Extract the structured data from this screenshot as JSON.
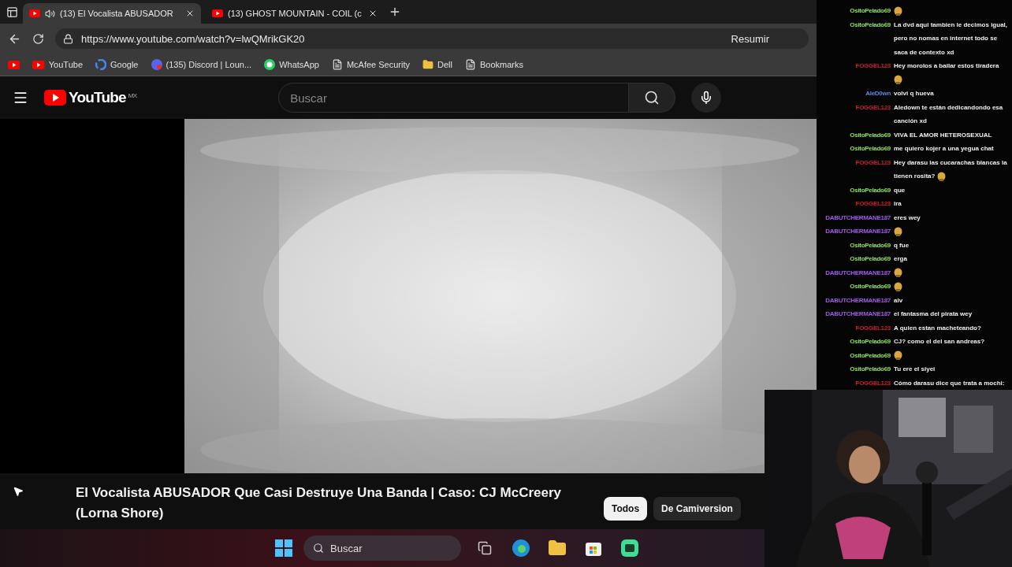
{
  "browser": {
    "tabs": [
      {
        "title": "(13) El Vocalista ABUSADOR",
        "selected": true,
        "audio": true
      },
      {
        "title": "(13) GHOST MOUNTAIN - COIL (c",
        "selected": false,
        "audio": false
      }
    ],
    "address": "https://www.youtube.com/watch?v=lwQMrikGK20",
    "summarize": "Resumir",
    "bookmarks": [
      {
        "kind": "youtube"
      },
      {
        "label": "YouTube",
        "kind": "youtube"
      },
      {
        "label": "Google",
        "kind": "google"
      },
      {
        "label": "(135) Discord | Loun...",
        "kind": "discord"
      },
      {
        "label": "WhatsApp",
        "kind": "whatsapp"
      },
      {
        "label": "McAfee Security",
        "kind": "page"
      },
      {
        "label": "Dell",
        "kind": "folder"
      },
      {
        "label": "Bookmarks",
        "kind": "page"
      }
    ]
  },
  "youtube": {
    "logo": "YouTube",
    "region": "MX",
    "search_placeholder": "Buscar",
    "title": "El Vocalista ABUSADOR Que Casi Destruye Una Banda | Caso: CJ McCreery (Lorna Shore)",
    "chips": [
      {
        "label": "Todos",
        "selected": true
      },
      {
        "label": "De Camiversion",
        "selected": false
      }
    ]
  },
  "chat": [
    {
      "user": "OsitoPelado69",
      "color": "#8fe05a",
      "emote": true
    },
    {
      "user": "OsitoPelado69",
      "color": "#8fe05a",
      "text": "La dvd aqui tambien le decimos igual, pero no nomas en internet todo se saca de contexto xd",
      "emote": false
    },
    {
      "user": "FOGGEL123",
      "color": "#c8202c",
      "text": "Hey morolos a bailar estos tiradera",
      "emote": true
    },
    {
      "user": "AleD0wn",
      "color": "#5a8ae8",
      "text": "volvi q hueva",
      "emote": false
    },
    {
      "user": "FOGGEL123",
      "color": "#c8202c",
      "text": "Aledown te están dedicandondo esa canción xd",
      "emote": false
    },
    {
      "user": "OsitoPelado69",
      "color": "#8fe05a",
      "text": "VIVA EL AMOR HETEROSEXUAL",
      "emote": false
    },
    {
      "user": "OsitoPelado69",
      "color": "#8fe05a",
      "text": "me quiero kojer a una yegua chat",
      "emote": false
    },
    {
      "user": "FOGGEL123",
      "color": "#c8202c",
      "text": "Hey darasu las cucarachas blancas la tienen rosita?",
      "emote": true
    },
    {
      "user": "OsitoPelado69",
      "color": "#8fe05a",
      "text": "que",
      "emote": false
    },
    {
      "user": "FOGGEL123",
      "color": "#c8202c",
      "text": "ira",
      "emote": false
    },
    {
      "user": "DABUTCHERMANE187",
      "color": "#a05ae8",
      "text": "eres wey",
      "emote": false
    },
    {
      "user": "DABUTCHERMANE187",
      "color": "#a05ae8",
      "emote": true
    },
    {
      "user": "OsitoPelado69",
      "color": "#8fe05a",
      "text": "q fue",
      "emote": false
    },
    {
      "user": "OsitoPelado69",
      "color": "#8fe05a",
      "text": "erga",
      "emote": false
    },
    {
      "user": "DABUTCHERMANE187",
      "color": "#a05ae8",
      "emote": true
    },
    {
      "user": "OsitoPelado69",
      "color": "#8fe05a",
      "emote": true
    },
    {
      "user": "DABUTCHERMANE187",
      "color": "#a05ae8",
      "text": "alv",
      "emote": false
    },
    {
      "user": "DABUTCHERMANE187",
      "color": "#a05ae8",
      "text": "el fantasma del pirata wey",
      "emote": false
    },
    {
      "user": "FOGGEL123",
      "color": "#c8202c",
      "text": "A quien estan macheteando?",
      "emote": false
    },
    {
      "user": "OsitoPelado69",
      "color": "#8fe05a",
      "text": "CJ? como el del san andreas?",
      "emote": false
    },
    {
      "user": "OsitoPelado69",
      "color": "#8fe05a",
      "emote": true
    },
    {
      "user": "OsitoPelado69",
      "color": "#8fe05a",
      "text": "Tu ere el siyei",
      "emote": false
    },
    {
      "user": "FOGGEL123",
      "color": "#c8202c",
      "text": "Cómo darasu dice que trata a mochi:",
      "emote": false
    }
  ],
  "taskbar": {
    "search_placeholder": "Buscar"
  }
}
